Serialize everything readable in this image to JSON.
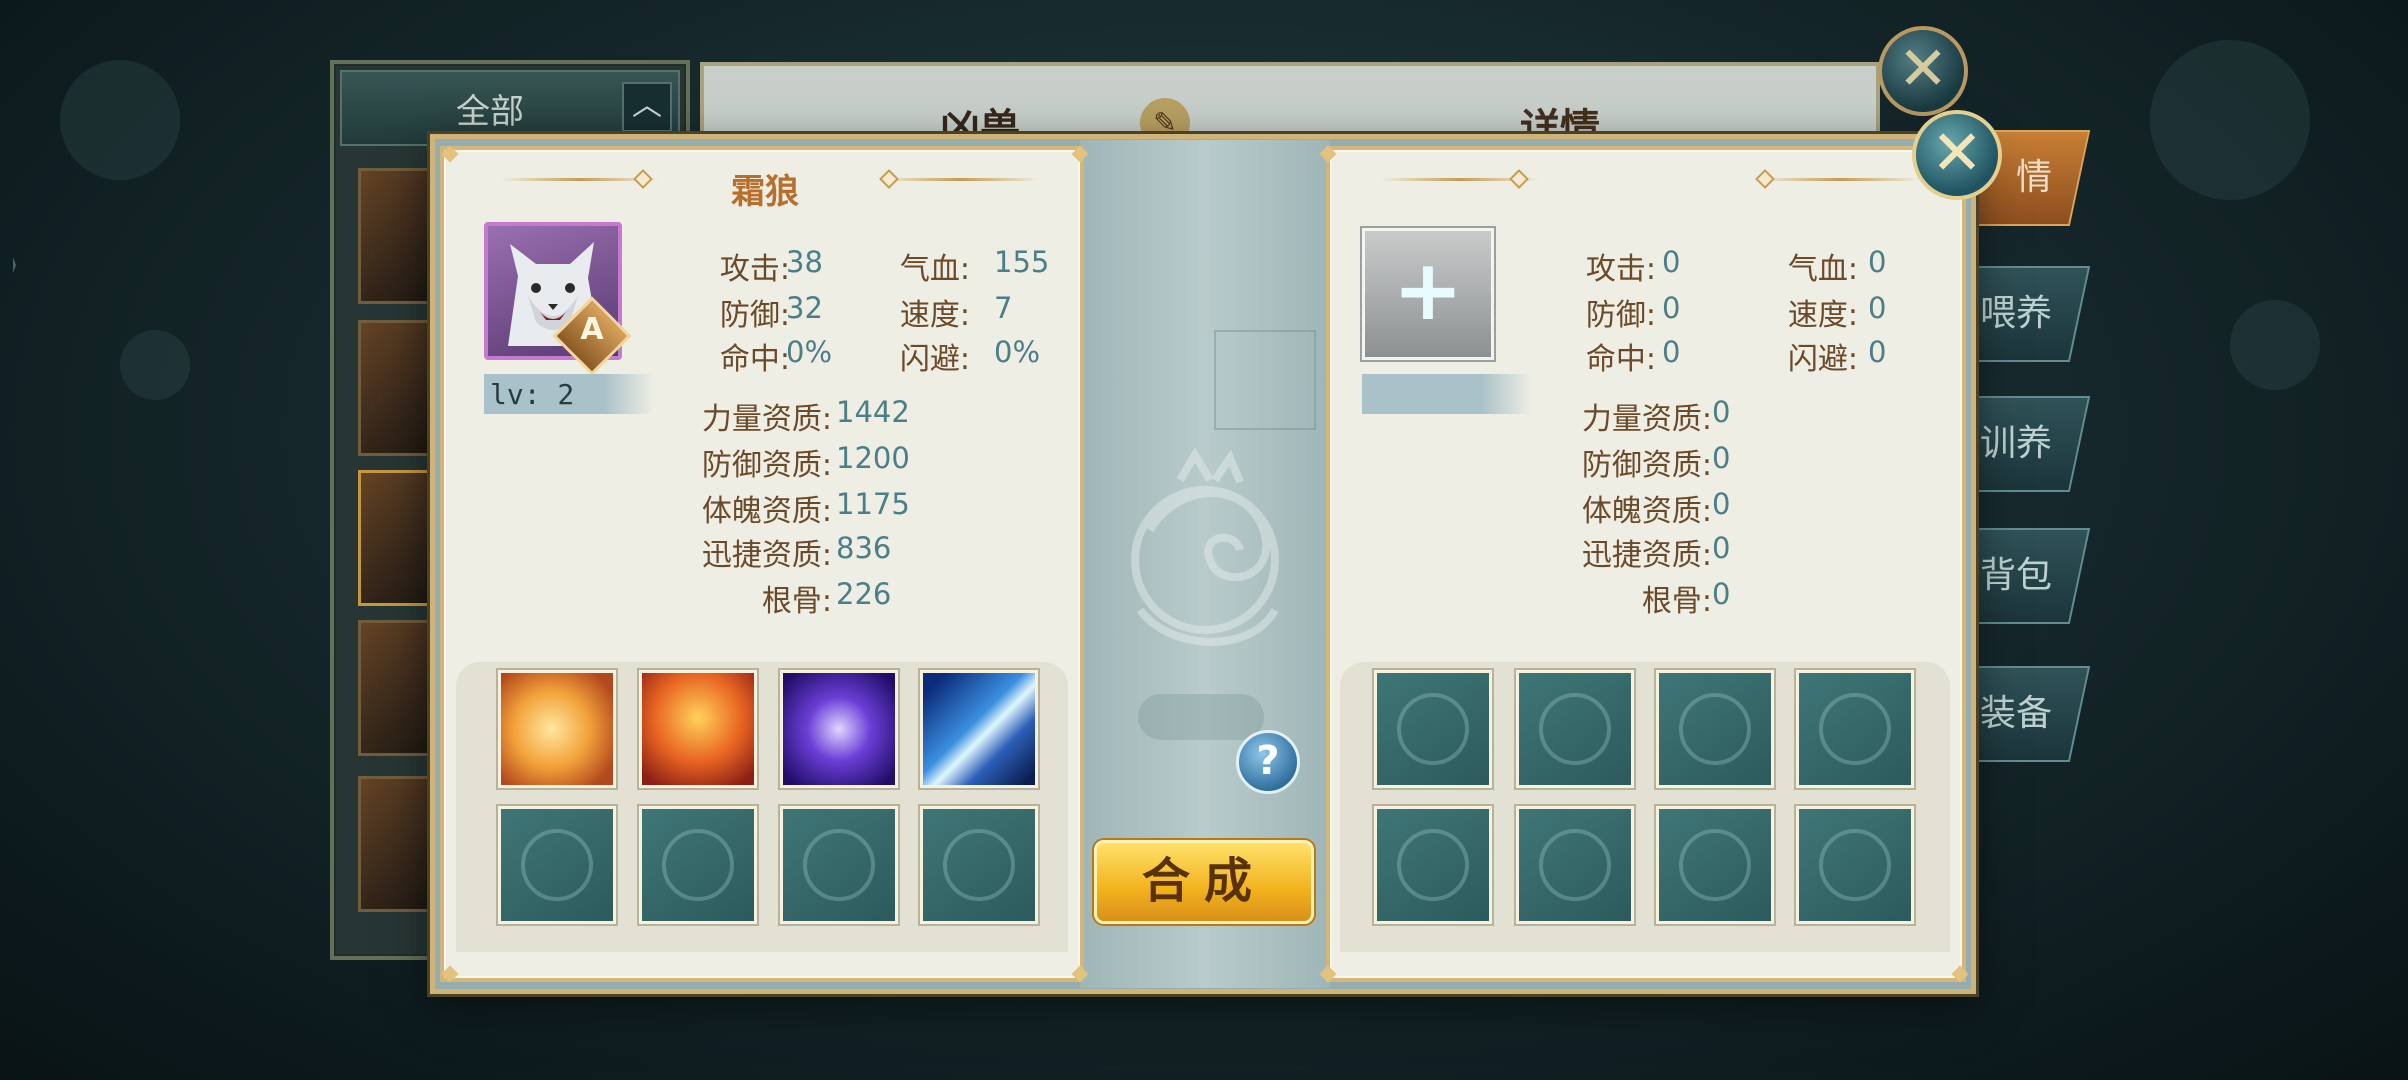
{
  "background": {
    "list": {
      "filter_label": "全部",
      "chevron_icon": "chevron-up-icon"
    },
    "panel_title": "凶兽",
    "detail_title": "详情",
    "side_tabs": [
      "情",
      "喂养",
      "训养",
      "背包",
      "装备"
    ],
    "close_icon": "close-icon"
  },
  "modal": {
    "close_icon": "close-icon",
    "left_pet": {
      "name": "霜狼",
      "grade": "A",
      "level_text": "lv: 2",
      "portrait_icon": "white-wolf-portrait",
      "stats": [
        {
          "label": "攻击:",
          "value": "38"
        },
        {
          "label": "气血:",
          "value": "155"
        },
        {
          "label": "防御:",
          "value": "32"
        },
        {
          "label": "速度:",
          "value": "7"
        },
        {
          "label": "命中:",
          "value": "0%"
        },
        {
          "label": "闪避:",
          "value": "0%"
        }
      ],
      "aptitudes": [
        {
          "label": "力量资质:",
          "value": "1442"
        },
        {
          "label": "防御资质:",
          "value": "1200"
        },
        {
          "label": "体魄资质:",
          "value": "1175"
        },
        {
          "label": "迅捷资质:",
          "value": "836"
        },
        {
          "label": "根骨:",
          "value": "226"
        }
      ],
      "skills": [
        "golden-lion-skill-icon",
        "flame-burst-skill-icon",
        "void-slash-skill-icon",
        "lightning-blade-skill-icon",
        "",
        "",
        "",
        ""
      ]
    },
    "right_pet": {
      "add_icon": "plus-icon",
      "stats": [
        {
          "label": "攻击:",
          "value": "0"
        },
        {
          "label": "气血:",
          "value": "0"
        },
        {
          "label": "防御:",
          "value": "0"
        },
        {
          "label": "速度:",
          "value": "0"
        },
        {
          "label": "命中:",
          "value": "0"
        },
        {
          "label": "闪避:",
          "value": "0"
        }
      ],
      "aptitudes": [
        {
          "label": "力量资质:",
          "value": "0"
        },
        {
          "label": "防御资质:",
          "value": "0"
        },
        {
          "label": "体魄资质:",
          "value": "0"
        },
        {
          "label": "迅捷资质:",
          "value": "0"
        },
        {
          "label": "根骨:",
          "value": "0"
        }
      ]
    },
    "help_label": "?",
    "compose_label": "合成",
    "colors": {
      "accent_gold": "#d2b67a",
      "label_brown": "#6b4a2a",
      "value_teal": "#4a7f88",
      "name_orange": "#b86f2c"
    }
  }
}
